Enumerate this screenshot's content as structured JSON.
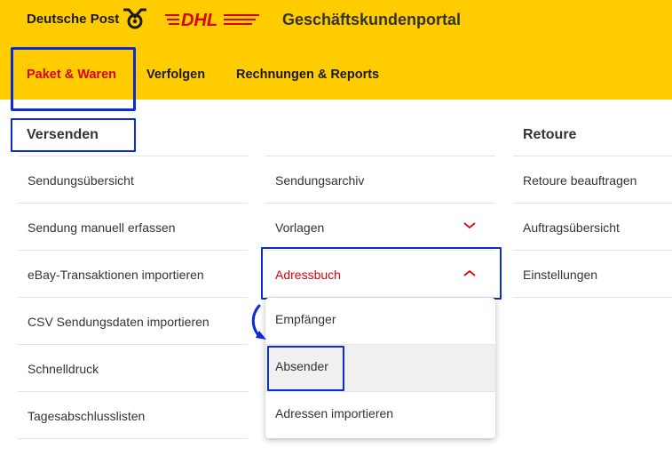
{
  "header": {
    "brand": "Deutsche Post",
    "dhl_logo": "DHL",
    "portal_title": "Geschäftskundenportal",
    "background": "#ffcc00"
  },
  "nav": {
    "items": [
      {
        "label": "Paket & Waren",
        "active": true
      },
      {
        "label": "Verfolgen",
        "active": false
      },
      {
        "label": "Rechnungen & Reports",
        "active": false
      }
    ]
  },
  "columns": {
    "versenden": {
      "title": "Versenden",
      "items": [
        "Sendungsübersicht",
        "Sendung manuell erfassen",
        "eBay-Transaktionen importieren",
        "CSV Sendungsdaten importieren",
        "Schnelldruck",
        "Tagesabschlusslisten"
      ]
    },
    "middle": {
      "items": [
        {
          "label": "Sendungsarchiv"
        },
        {
          "label": "Vorlagen",
          "state": "collapsed",
          "icon": "chevron-down-icon"
        },
        {
          "label": "Adressbuch",
          "state": "expanded",
          "icon": "chevron-up-icon"
        }
      ]
    },
    "retoure": {
      "title": "Retoure",
      "items": [
        "Retoure beauftragen",
        "Auftragsübersicht",
        "Einstellungen"
      ]
    }
  },
  "address_dropdown": {
    "items": [
      "Empfänger",
      "Absender",
      "Adressen importieren"
    ],
    "hovered": "Absender"
  },
  "colors": {
    "accent_red": "#d40511",
    "highlight_blue": "#0a2bd8",
    "text": "#333333"
  }
}
